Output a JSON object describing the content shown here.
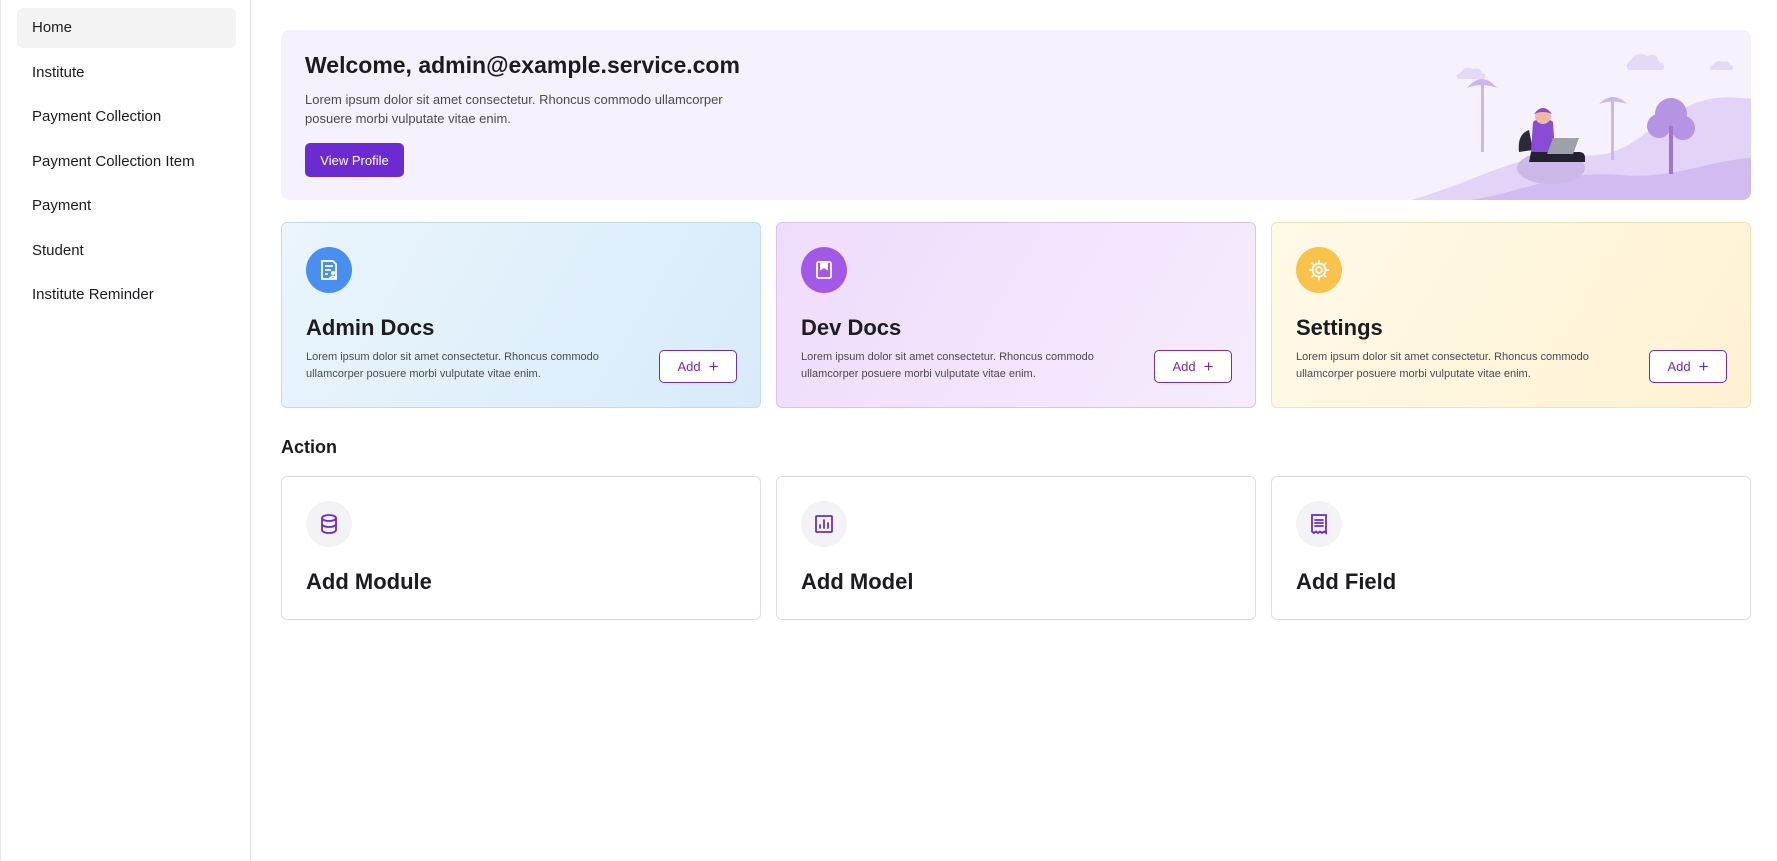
{
  "sidebar": {
    "items": [
      {
        "label": "Home",
        "active": true
      },
      {
        "label": "Institute"
      },
      {
        "label": "Payment Collection"
      },
      {
        "label": "Payment Collection Item"
      },
      {
        "label": "Payment"
      },
      {
        "label": "Student"
      },
      {
        "label": "Institute Reminder"
      }
    ]
  },
  "welcome": {
    "title": "Welcome, admin@example.service.com",
    "text": "Lorem ipsum dolor sit amet consectetur. Rhoncus commodo ullamcorper posuere morbi vulputate vitae enim.",
    "button_label": "View Profile"
  },
  "cards": [
    {
      "title": "Admin Docs",
      "description": "Lorem ipsum dolor sit amet consectetur. Rhoncus commodo ullamcorper posuere morbi vulputate vitae enim.",
      "button_label": "Add",
      "icon": "admin-docs-icon",
      "icon_color": "#4a8ff0"
    },
    {
      "title": "Dev Docs",
      "description": "Lorem ipsum dolor sit amet consectetur. Rhoncus commodo ullamcorper posuere morbi vulputate vitae enim.",
      "button_label": "Add",
      "icon": "dev-docs-icon",
      "icon_color": "#a259e6"
    },
    {
      "title": "Settings",
      "description": "Lorem ipsum dolor sit amet consectetur. Rhoncus commodo ullamcorper posuere morbi vulputate vitae enim.",
      "button_label": "Add",
      "icon": "gear-icon",
      "icon_color": "#f9c24a"
    }
  ],
  "actions": {
    "title": "Action",
    "items": [
      {
        "title": "Add Module",
        "icon": "database-icon"
      },
      {
        "title": "Add Model",
        "icon": "chart-icon"
      },
      {
        "title": "Add Field",
        "icon": "list-icon"
      }
    ]
  },
  "colors": {
    "accent": "#6c2bd0",
    "welcome_bg": "#f6f2fd",
    "sidebar_active_bg": "#f3f3f3"
  }
}
